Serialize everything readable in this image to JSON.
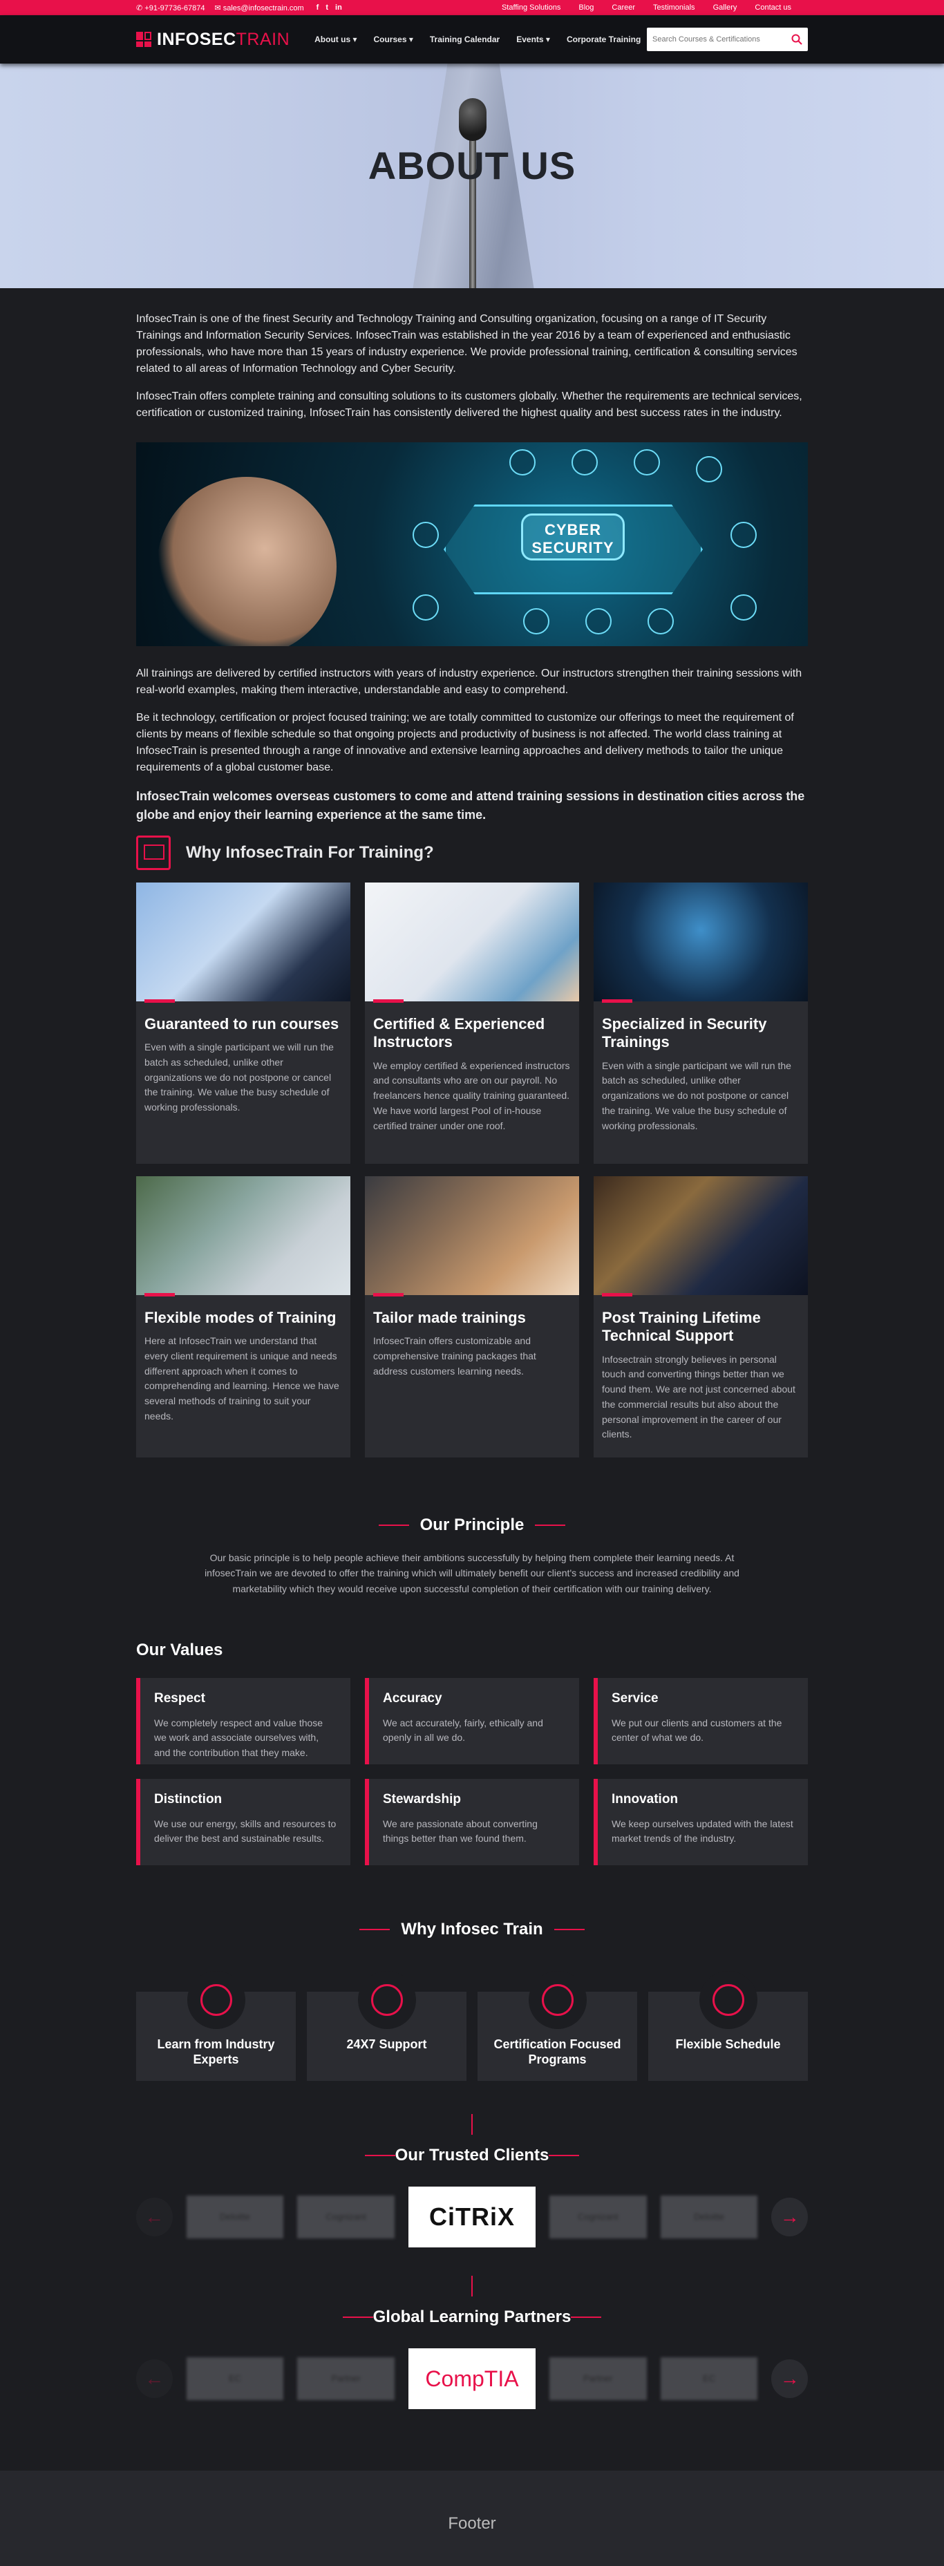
{
  "topbar": {
    "phone": "+91-97736-67874",
    "email": "sales@infosectrain.com",
    "social": [
      "f",
      "t",
      "in"
    ],
    "links": [
      "Staffing Solutions",
      "Blog",
      "Career",
      "Testimonials",
      "Gallery",
      "Contact us"
    ]
  },
  "nav": {
    "logo_a": "INFOSEC",
    "logo_b": "TRAIN",
    "menu": [
      "About us ▾",
      "Courses ▾",
      "Training Calendar",
      "Events ▾",
      "Corporate Training"
    ],
    "search_placeholder": "Search Courses & Certifications"
  },
  "hero": {
    "title": "ABOUT US"
  },
  "intro": {
    "p1": "InfosecTrain is one of the finest Security and Technology Training and Consulting organization, focusing on a range of IT Security Trainings and Information Security Services. InfosecTrain was established in the year 2016 by a team of experienced and enthusiastic professionals, who have more than 15 years of industry experience. We provide professional training, certification & consulting services related to all areas of Information Technology and Cyber Security.",
    "p2": "InfosecTrain offers complete training and consulting solutions to its customers globally. Whether the requirements are technical services, certification or customized training, InfosecTrain has consistently delivered the highest quality and best success rates in the industry.",
    "banner": "CYBER SECURITY",
    "p3": "All trainings are delivered by certified instructors with years of industry experience. Our instructors strengthen their training sessions with real-world examples, making them interactive, understandable and easy to comprehend.",
    "p4": "Be it technology, certification or project focused training; we are totally committed to customize our offerings to meet the requirement of clients by means of flexible schedule so that ongoing projects and productivity of business is not affected. The world class training at InfosecTrain is presented through a range of innovative and extensive learning approaches and delivery methods to tailor the unique requirements of a global customer base.",
    "lead": "InfosecTrain welcomes overseas customers to come and attend training sessions in destination cities across the globe and enjoy their learning experience at the same time."
  },
  "why_training": {
    "title": "Why InfosecTrain For Training?",
    "cards": [
      {
        "title": "Guaranteed to run courses",
        "text": "Even with a single participant we will run the batch as scheduled, unlike other organizations we do not postpone or cancel the training. We value the busy schedule of working professionals."
      },
      {
        "title": "Certified & Experienced Instructors",
        "text": "We employ certified & experienced instructors and consultants who are on our payroll. No freelancers hence quality training guaranteed. We have world largest Pool of in-house certified trainer under one roof."
      },
      {
        "title": "Specialized in Security Trainings",
        "text": "Even with a single participant we will run the batch as scheduled, unlike other organizations we do not postpone or cancel the training. We value the busy schedule of working professionals."
      },
      {
        "title": "Flexible modes of Training",
        "text": "Here at InfosecTrain we understand that every client requirement is unique and needs different approach when it comes to comprehending and learning. Hence we have several methods of training to suit your needs."
      },
      {
        "title": "Tailor made trainings",
        "text": "InfosecTrain offers customizable and comprehensive training packages that address customers learning needs."
      },
      {
        "title": "Post Training Lifetime Technical Support",
        "text": "Infosectrain strongly believes in personal touch and converting things better than we found them. We are not just concerned about the commercial results but also about the personal improvement in the career of our clients."
      }
    ]
  },
  "principle": {
    "title": "Our Principle",
    "text": "Our basic principle is to help people achieve their ambitions successfully by helping them complete their learning needs. At infosecTrain we are devoted to offer the training which will ultimately benefit our client's success and increased credibility and marketability which they would receive upon successful completion of their certification with our training delivery."
  },
  "values": {
    "title": "Our Values",
    "items": [
      {
        "title": "Respect",
        "text": "We completely respect and value those we work and associate ourselves with, and the contribution that they make."
      },
      {
        "title": "Accuracy",
        "text": "We act accurately, fairly, ethically and openly in all we do."
      },
      {
        "title": "Service",
        "text": "We put our clients and customers at the center of what we do."
      },
      {
        "title": "Distinction",
        "text": "We use our energy, skills and resources to deliver the best and sustainable results."
      },
      {
        "title": "Stewardship",
        "text": "We are passionate about converting things better than we found them."
      },
      {
        "title": "Innovation",
        "text": "We keep ourselves updated with the latest market trends of the industry."
      }
    ]
  },
  "why_infosec": {
    "title": "Why Infosec Train",
    "items": [
      "Learn from Industry Experts",
      "24X7 Support",
      "Certification Focused Programs",
      "Flexible Schedule"
    ]
  },
  "clients": {
    "title": "Our Trusted Clients",
    "logos": [
      "Deloitte",
      "Cognizant",
      "CiTRiX",
      "Cognizant",
      "Deloitte"
    ]
  },
  "partners": {
    "title": "Global Learning Partners",
    "logos": [
      "EC",
      "Partner",
      "CompTIA",
      "Partner",
      "EC"
    ]
  },
  "footer": {
    "text": "Footer"
  },
  "colors": {
    "accent": "#e8114a",
    "bg": "#1c1d21",
    "card": "#2b2c31"
  }
}
